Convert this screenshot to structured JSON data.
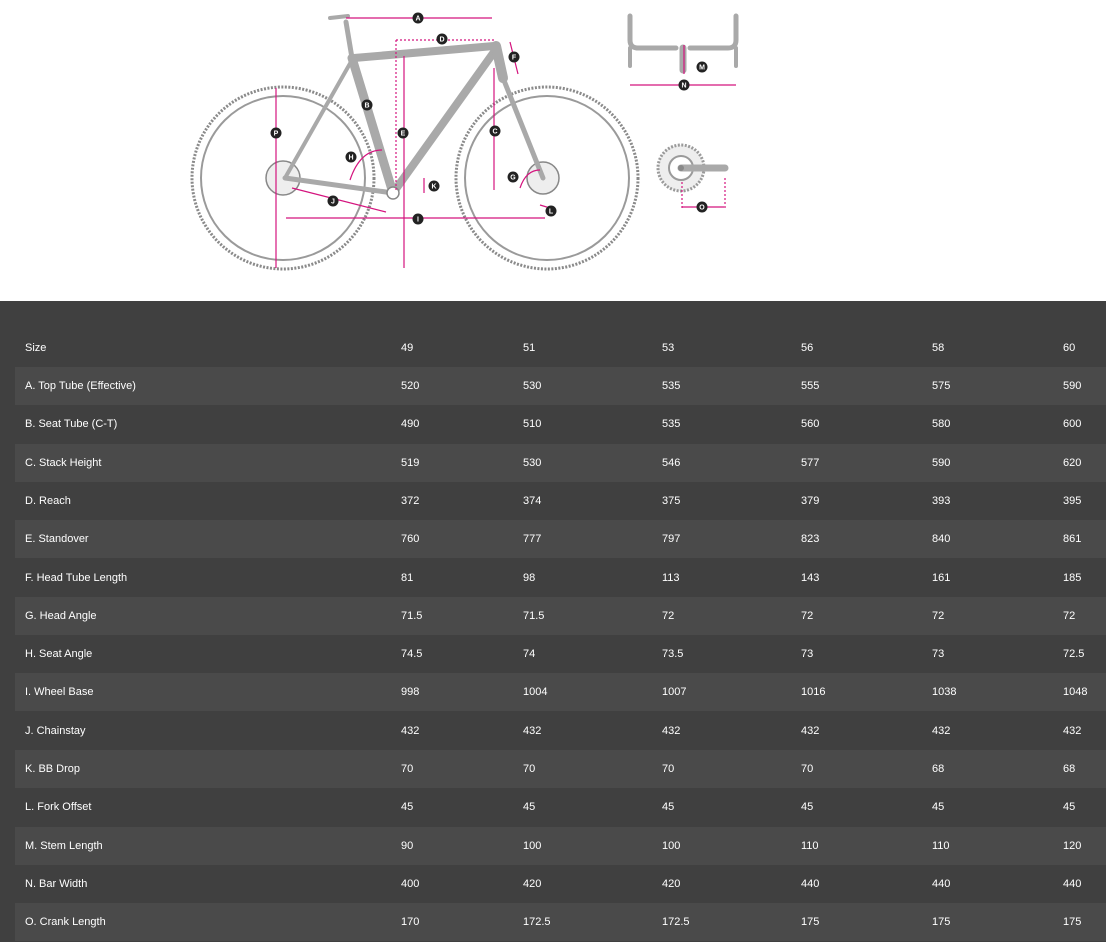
{
  "colors": {
    "accent": "#d4147e",
    "table_bg": "#404040",
    "row_alt_bg": "#4a4a4a",
    "text": "#ffffff"
  },
  "diagram": {
    "letters": [
      "A",
      "B",
      "C",
      "D",
      "E",
      "F",
      "G",
      "H",
      "I",
      "J",
      "K",
      "L",
      "M",
      "N",
      "O",
      "P"
    ]
  },
  "table": {
    "header": {
      "label": "Size",
      "values": [
        "49",
        "51",
        "53",
        "56",
        "58",
        "60"
      ]
    },
    "rows": [
      {
        "label": "A. Top Tube (Effective)",
        "values": [
          "520",
          "530",
          "535",
          "555",
          "575",
          "590"
        ]
      },
      {
        "label": "B. Seat Tube (C-T)",
        "values": [
          "490",
          "510",
          "535",
          "560",
          "580",
          "600"
        ]
      },
      {
        "label": "C. Stack Height",
        "values": [
          "519",
          "530",
          "546",
          "577",
          "590",
          "620"
        ]
      },
      {
        "label": "D. Reach",
        "values": [
          "372",
          "374",
          "375",
          "379",
          "393",
          "395"
        ]
      },
      {
        "label": "E. Standover",
        "values": [
          "760",
          "777",
          "797",
          "823",
          "840",
          "861"
        ]
      },
      {
        "label": "F. Head Tube Length",
        "values": [
          "81",
          "98",
          "113",
          "143",
          "161",
          "185"
        ]
      },
      {
        "label": "G. Head Angle",
        "values": [
          "71.5",
          "71.5",
          "72",
          "72",
          "72",
          "72"
        ]
      },
      {
        "label": "H. Seat Angle",
        "values": [
          "74.5",
          "74",
          "73.5",
          "73",
          "73",
          "72.5"
        ]
      },
      {
        "label": "I. Wheel Base",
        "values": [
          "998",
          "1004",
          "1007",
          "1016",
          "1038",
          "1048"
        ]
      },
      {
        "label": "J. Chainstay",
        "values": [
          "432",
          "432",
          "432",
          "432",
          "432",
          "432"
        ]
      },
      {
        "label": "K. BB Drop",
        "values": [
          "70",
          "70",
          "70",
          "70",
          "68",
          "68"
        ]
      },
      {
        "label": "L. Fork Offset",
        "values": [
          "45",
          "45",
          "45",
          "45",
          "45",
          "45"
        ]
      },
      {
        "label": "M. Stem Length",
        "values": [
          "90",
          "100",
          "100",
          "110",
          "110",
          "120"
        ]
      },
      {
        "label": "N. Bar Width",
        "values": [
          "400",
          "420",
          "420",
          "440",
          "440",
          "440"
        ]
      },
      {
        "label": "O. Crank Length",
        "values": [
          "170",
          "172.5",
          "172.5",
          "175",
          "175",
          "175"
        ]
      }
    ]
  }
}
